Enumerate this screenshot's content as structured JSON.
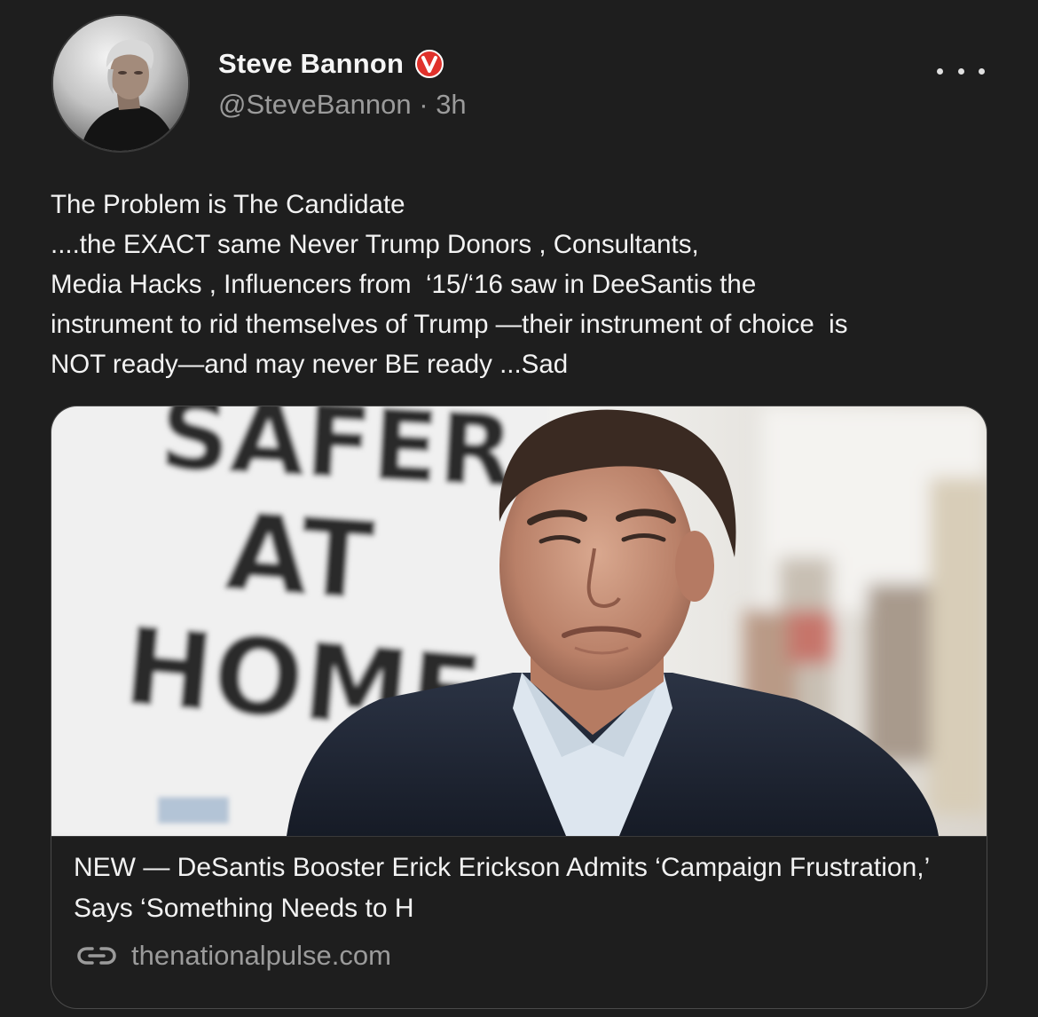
{
  "author": {
    "name": "Steve Bannon",
    "handle": "@SteveBannon",
    "separator": "·",
    "time_ago": "3h",
    "verified_icon": "verified-v-badge-icon",
    "badge_color": "#e0312b"
  },
  "menu": {
    "more_icon": "more-horizontal-icon"
  },
  "post": {
    "text": "The Problem is The Candidate\n....the EXACT same Never Trump Donors , Consultants,\nMedia Hacks , Influencers from  ‘15/‘16 saw in DeeSantis the\ninstrument to rid themselves of Trump —their instrument of choice  is\nNOT ready—and may never BE ready ...Sad"
  },
  "link_card": {
    "image_sign_text": [
      "SAFER",
      "AT",
      "HOME"
    ],
    "headline": "NEW — DeSantis Booster Erick Erickson Admits ‘Campaign Frustration,’ Says ‘Something Needs to H",
    "domain": "thenationalpulse.com",
    "link_icon": "link-chain-icon"
  },
  "colors": {
    "background": "#1e1e1e",
    "text_primary": "#f2f2f2",
    "text_secondary": "#9b9b9b",
    "card_border": "#4a4a4a"
  }
}
